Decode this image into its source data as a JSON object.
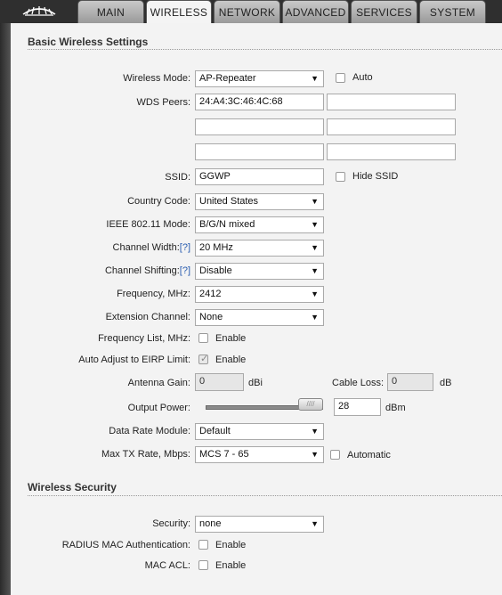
{
  "tabs": [
    {
      "label": "MAIN"
    },
    {
      "label": "WIRELESS"
    },
    {
      "label": "NETWORK"
    },
    {
      "label": "ADVANCED"
    },
    {
      "label": "SERVICES"
    },
    {
      "label": "SYSTEM"
    }
  ],
  "active_tab": "WIRELESS",
  "basic": {
    "title": "Basic Wireless Settings",
    "wireless_mode": {
      "label": "Wireless Mode:",
      "value": "AP-Repeater",
      "auto_label": "Auto",
      "auto_checked": false
    },
    "wds_peers": {
      "label": "WDS Peers:",
      "values": [
        "24:A4:3C:46:4C:68",
        "",
        "",
        "",
        "",
        ""
      ]
    },
    "ssid": {
      "label": "SSID:",
      "value": "GGWP",
      "hide_label": "Hide SSID",
      "hide_checked": false
    },
    "country": {
      "label": "Country Code:",
      "value": "United States"
    },
    "ieee_mode": {
      "label": "IEEE 802.11 Mode:",
      "value": "B/G/N mixed"
    },
    "channel_width": {
      "label": "Channel Width:",
      "help": "[?]",
      "value": "20 MHz"
    },
    "channel_shifting": {
      "label": "Channel Shifting:",
      "help": "[?]",
      "value": "Disable"
    },
    "frequency": {
      "label": "Frequency, MHz:",
      "value": "2412"
    },
    "extension_channel": {
      "label": "Extension Channel:",
      "value": "None"
    },
    "frequency_list": {
      "label": "Frequency List, MHz:",
      "enable_label": "Enable",
      "checked": false
    },
    "auto_eirp": {
      "label": "Auto Adjust to EIRP Limit:",
      "enable_label": "Enable",
      "checked": true
    },
    "antenna_gain": {
      "label": "Antenna Gain:",
      "value": "0",
      "unit": "dBi"
    },
    "cable_loss": {
      "label": "Cable Loss:",
      "value": "0",
      "unit": "dB"
    },
    "output_power": {
      "label": "Output Power:",
      "value": "28",
      "unit": "dBm",
      "slider_fraction": 1.0
    },
    "data_rate_module": {
      "label": "Data Rate Module:",
      "value": "Default"
    },
    "max_tx_rate": {
      "label": "Max TX Rate, Mbps:",
      "value": "MCS 7 - 65",
      "automatic_label": "Automatic",
      "automatic_checked": false
    }
  },
  "security": {
    "title": "Wireless Security",
    "security": {
      "label": "Security:",
      "value": "none"
    },
    "radius_mac": {
      "label": "RADIUS MAC Authentication:",
      "enable_label": "Enable",
      "checked": false
    },
    "mac_acl": {
      "label": "MAC ACL:",
      "enable_label": "Enable",
      "checked": false
    }
  },
  "colors": {
    "help_link": "#2a5db0",
    "panel_bg": "#f3f3f3",
    "frame_bg": "#3c3c3c"
  },
  "icons": {
    "logo": "ubiquiti-logo-icon",
    "dropdown": "chevron-down-icon"
  }
}
